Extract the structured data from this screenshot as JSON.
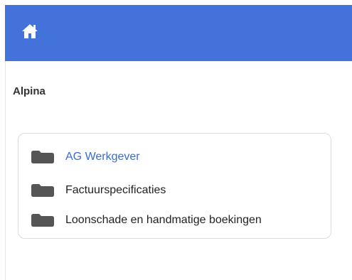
{
  "header": {
    "home_icon": "home-icon",
    "accent_color": "#4472db"
  },
  "main": {
    "company_name": "Alpina",
    "folders": [
      {
        "label": "AG Werkgever",
        "icon": "folder-icon",
        "active": true
      },
      {
        "label": "Factuurspecificaties",
        "icon": "folder-icon",
        "active": false
      },
      {
        "label": "Loonschade en handmatige boekingen",
        "icon": "folder-icon",
        "active": false
      }
    ]
  }
}
